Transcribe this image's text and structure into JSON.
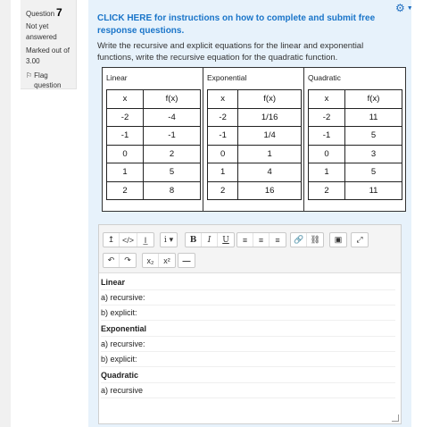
{
  "question_info": {
    "label": "Question",
    "number": "7",
    "status": "Not yet answered",
    "marked": "Marked out of 3.00",
    "flag_label": "Flag question"
  },
  "question": {
    "instructions_link": "CLICK HERE for instructions on how to complete and submit free response questions.",
    "prompt": "Write the recursive and explicit equations for the linear and exponential functions, write the recursive equation for the quadratic function."
  },
  "tables": [
    {
      "title": "Linear",
      "headers": [
        "x",
        "f(x)"
      ],
      "rows": [
        [
          "-2",
          "-4"
        ],
        [
          "-1",
          "-1"
        ],
        [
          "0",
          "2"
        ],
        [
          "1",
          "5"
        ],
        [
          "2",
          "8"
        ]
      ]
    },
    {
      "title": "Exponential",
      "headers": [
        "x",
        "f(x)"
      ],
      "rows": [
        [
          "-2",
          "1/16"
        ],
        [
          "-1",
          "1/4"
        ],
        [
          "0",
          "1"
        ],
        [
          "1",
          "4"
        ],
        [
          "2",
          "16"
        ]
      ]
    },
    {
      "title": "Quadratic",
      "headers": [
        "x",
        "f(x)"
      ],
      "rows": [
        [
          "-2",
          "11"
        ],
        [
          "-1",
          "5"
        ],
        [
          "0",
          "3"
        ],
        [
          "1",
          "5"
        ],
        [
          "2",
          "11"
        ]
      ]
    }
  ],
  "toolbar": {
    "collapse": "↥",
    "html": "</>",
    "clear_format": "I̲",
    "info": "i ▾",
    "bold": "B",
    "italic": "I",
    "underline": "U",
    "align_left": "≡",
    "align_center": "≡",
    "align_right": "≡",
    "link": "🔗",
    "unlink": "⛓",
    "image": "▣",
    "fullscreen": "⤢",
    "undo": "↶",
    "redo": "↷",
    "subscript": "x₂",
    "superscript": "x²",
    "hr": "—"
  },
  "answer_lines": [
    {
      "text": "Linear",
      "bold": true
    },
    {
      "text": "a) recursive:",
      "bold": false
    },
    {
      "text": "b) explicit:",
      "bold": false
    },
    {
      "text": "Exponential",
      "bold": true
    },
    {
      "text": "a) recursive:",
      "bold": false
    },
    {
      "text": "b) explicit:",
      "bold": false
    },
    {
      "text": "Quadratic",
      "bold": true
    },
    {
      "text": "a) recursive",
      "bold": false
    }
  ],
  "colors": {
    "link": "#1a75c9",
    "question_bg": "#e7f2fb",
    "gear": "#1f6ec0"
  }
}
